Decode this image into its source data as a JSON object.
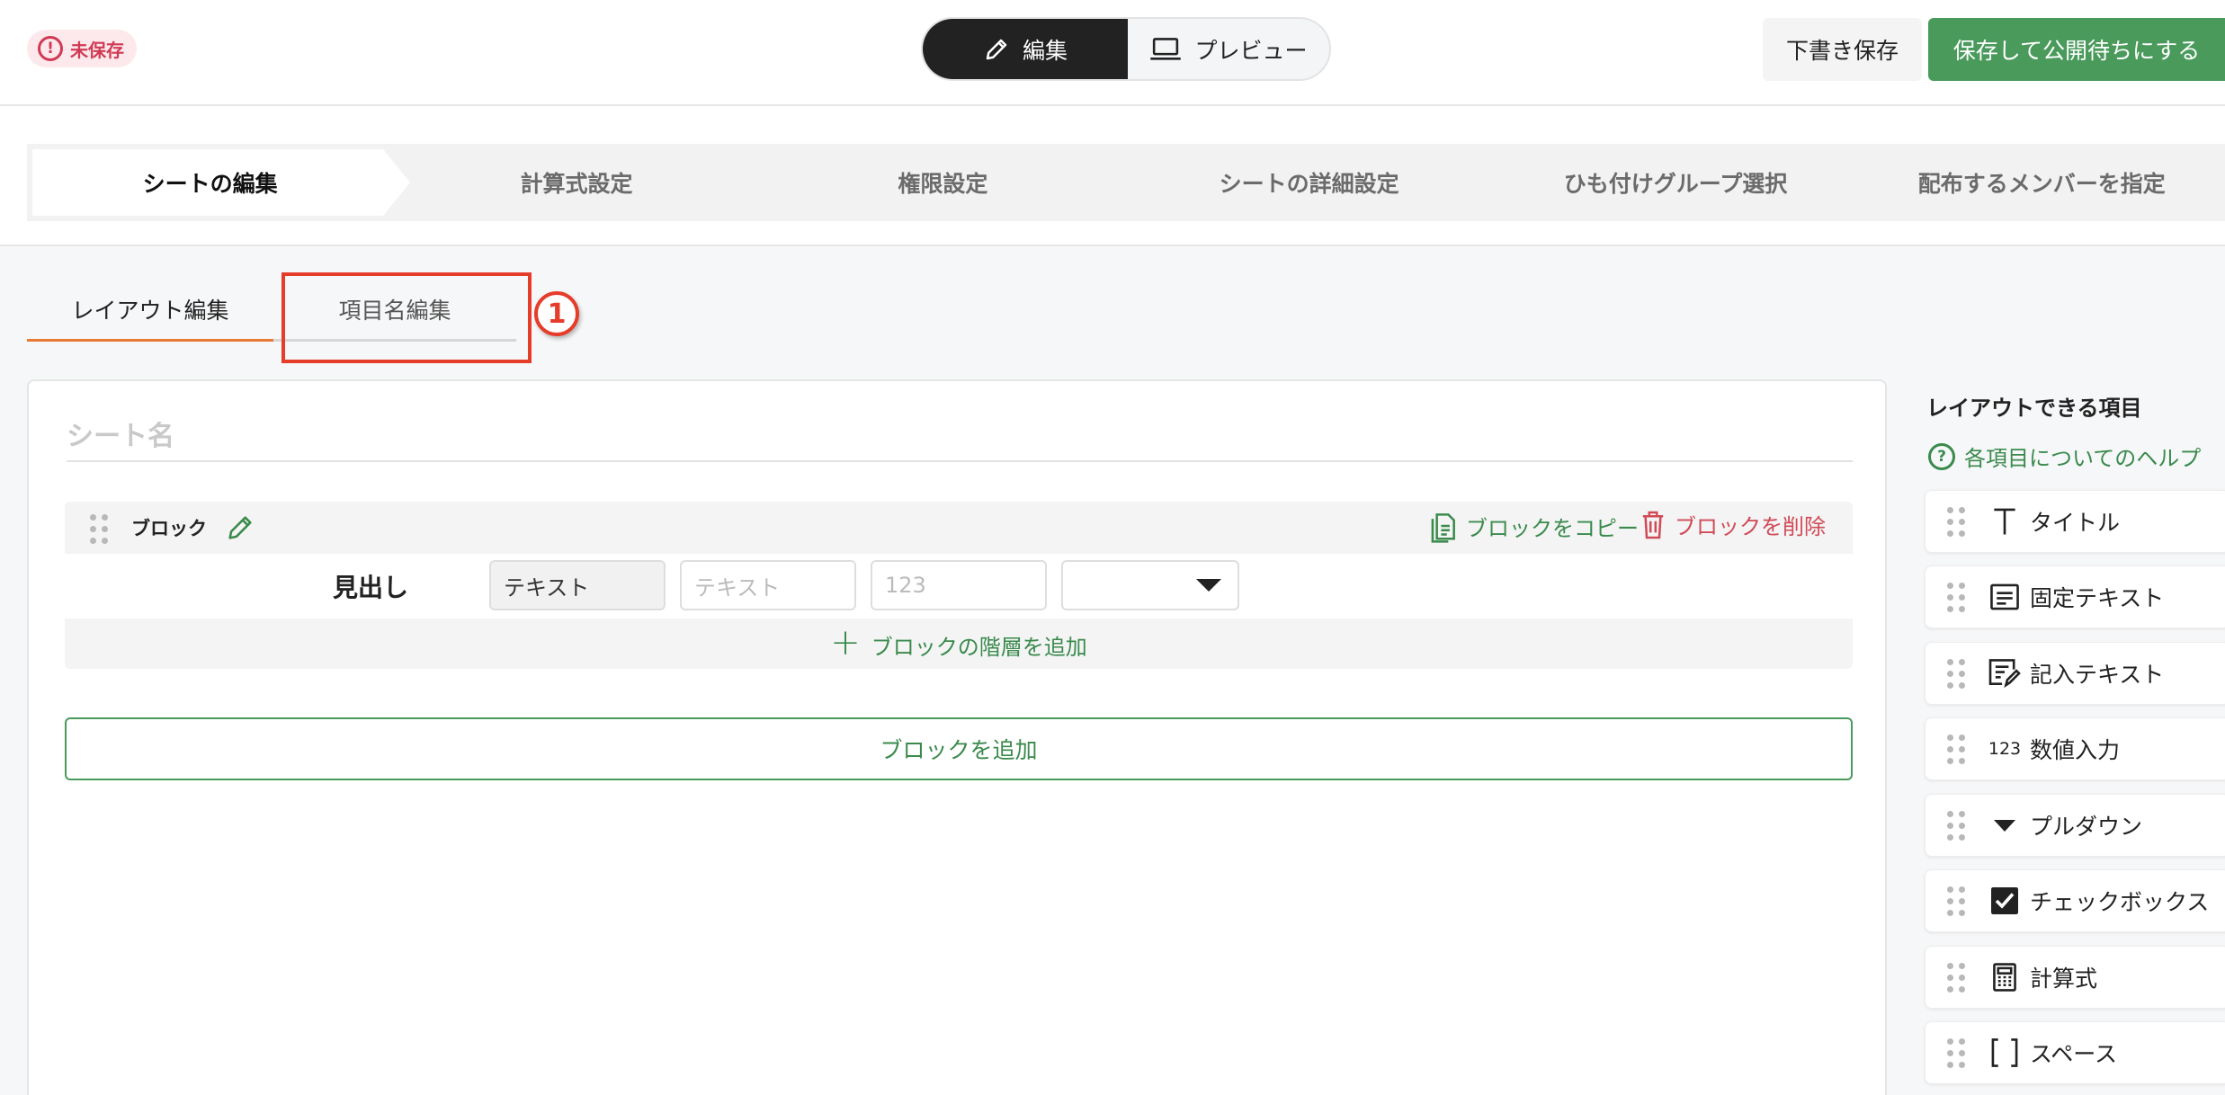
{
  "header": {
    "unsaved_badge": "未保存",
    "mode_edit": "編集",
    "mode_preview": "プレビュー",
    "draft_save": "下書き保存",
    "publish": "保存して公開待ちにする"
  },
  "steps": [
    {
      "label": "シートの編集",
      "active": true
    },
    {
      "label": "計算式設定",
      "active": false
    },
    {
      "label": "権限設定",
      "active": false
    },
    {
      "label": "シートの詳細設定",
      "active": false
    },
    {
      "label": "ひも付けグループ選択",
      "active": false
    },
    {
      "label": "配布するメンバーを指定",
      "active": false
    }
  ],
  "tabs": {
    "layout": "レイアウト編集",
    "names": "項目名編集",
    "annotation_marker": "1"
  },
  "sheet": {
    "name_placeholder": "シート名"
  },
  "block": {
    "title": "ブロック",
    "copy": "ブロックをコピー",
    "delete": "ブロックを削除",
    "row": {
      "heading": "見出し",
      "text_select": "テキスト",
      "text_placeholder": "テキスト",
      "number_placeholder": "123"
    },
    "add_level": "ブロックの階層を追加"
  },
  "add_block": "ブロックを追加",
  "palette": {
    "title": "レイアウトできる項目",
    "help": "各項目についてのヘルプ",
    "items": [
      {
        "label": "タイトル",
        "icon": "title-icon"
      },
      {
        "label": "固定テキスト",
        "icon": "fixed-text-icon"
      },
      {
        "label": "記入テキスト",
        "icon": "input-text-icon"
      },
      {
        "label": "数値入力",
        "icon": "number-icon",
        "icon_text": "123"
      },
      {
        "label": "プルダウン",
        "icon": "dropdown-icon"
      },
      {
        "label": "チェックボックス",
        "icon": "checkbox-icon"
      },
      {
        "label": "計算式",
        "icon": "calculator-icon"
      },
      {
        "label": "スペース",
        "icon": "space-icon"
      }
    ]
  },
  "colors": {
    "accent_green": "#4a9a5c",
    "danger_red": "#d04a56",
    "tab_orange": "#e87a35",
    "annotation_red": "#e63c2a"
  }
}
